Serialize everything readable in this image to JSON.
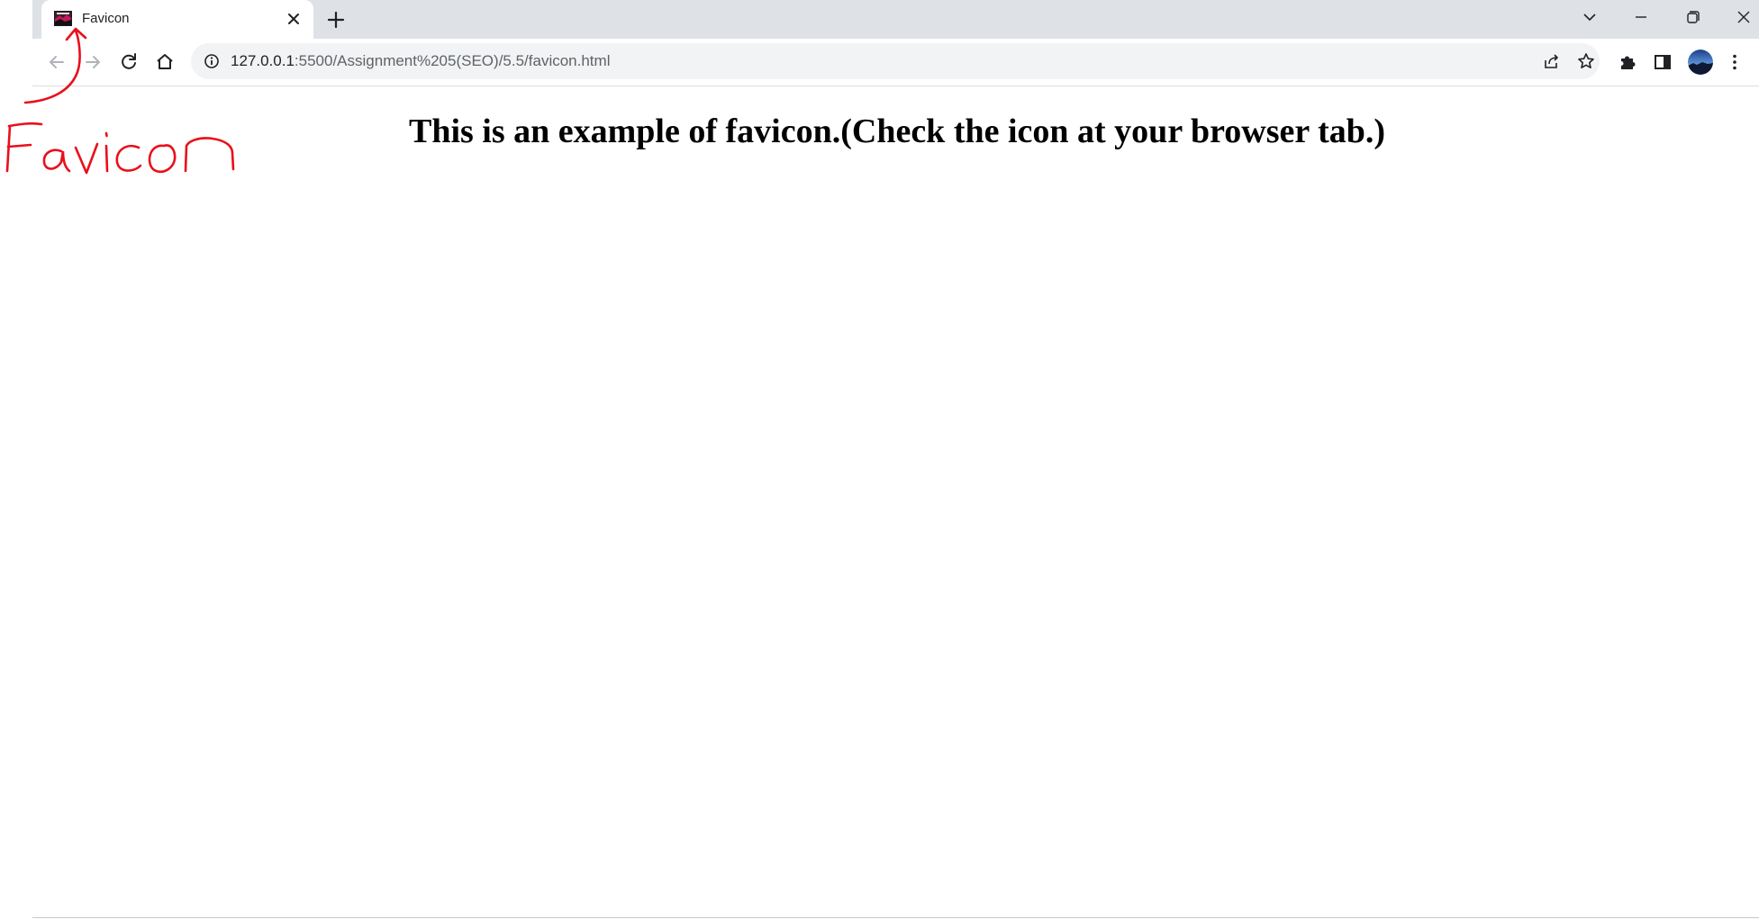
{
  "browser": {
    "tab": {
      "title": "Favicon",
      "favicon_icon": "favicon-image-icon",
      "close_icon": "close-icon"
    },
    "new_tab_icon": "plus-icon",
    "window_controls": [
      "chevron-down-icon",
      "minimize-icon",
      "restore-icon",
      "close-icon"
    ],
    "toolbar": {
      "back_icon": "arrow-left-icon",
      "forward_icon": "arrow-right-icon",
      "reload_icon": "reload-icon",
      "home_icon": "home-icon",
      "site_info_icon": "info-icon",
      "url_host": "127.0.0.1",
      "url_rest": ":5500/Assignment%205(SEO)/5.5/favicon.html",
      "share_icon": "share-icon",
      "bookmark_icon": "star-icon",
      "extensions_icon": "puzzle-icon",
      "side_panel_icon": "side-panel-icon",
      "profile_icon": "avatar",
      "menu_icon": "kebab-menu-icon"
    }
  },
  "page": {
    "heading": "This is an example of favicon.(Check the icon at your browser tab.)"
  },
  "annotation": {
    "text": "Favicon",
    "color": "#e8101b"
  },
  "colors": {
    "tab_strip": "#dee1e6",
    "omnibox": "#f1f3f4",
    "text": "#202124"
  }
}
